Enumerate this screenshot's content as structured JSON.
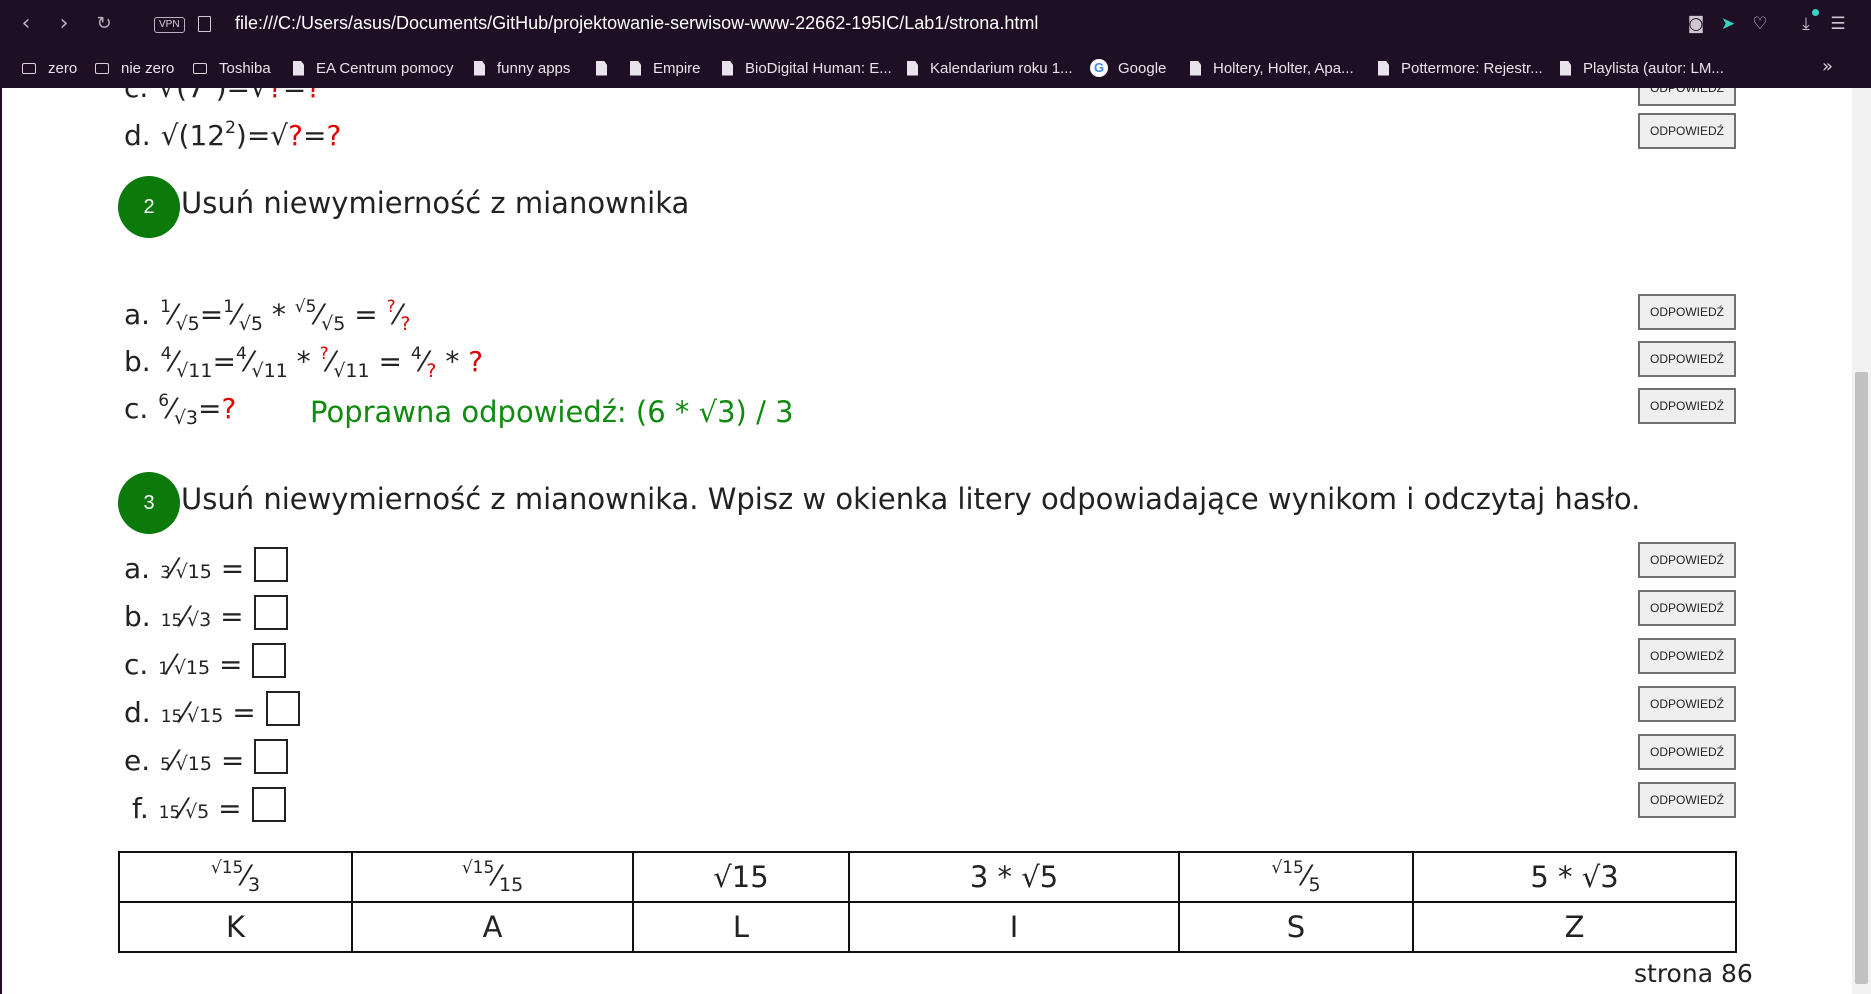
{
  "browser": {
    "vpn_label": "VPN",
    "url": "file:///C:/Users/asus/Documents/GitHub/projektowanie-serwisow-www-22662-195IC/Lab1/strona.html",
    "bookmarks": [
      {
        "label": "zero",
        "icon": "folder-icon"
      },
      {
        "label": "nie zero",
        "icon": "folder-icon"
      },
      {
        "label": "Toshiba",
        "icon": "folder-icon"
      },
      {
        "label": "EA Centrum pomocy",
        "icon": "page-icon"
      },
      {
        "label": "funny apps",
        "icon": "page-icon"
      },
      {
        "label": "",
        "icon": "page-icon"
      },
      {
        "label": "Empire",
        "icon": "page-icon"
      },
      {
        "label": "BioDigital Human: E...",
        "icon": "page-icon"
      },
      {
        "label": "Kalendarium roku 1...",
        "icon": "page-icon"
      },
      {
        "label": "Google",
        "icon": "google-icon"
      },
      {
        "label": "Holtery, Holter, Apa...",
        "icon": "page-icon"
      },
      {
        "label": "Pottermore: Rejestr...",
        "icon": "page-icon"
      },
      {
        "label": "Playlista (autor: LM...",
        "icon": "page-icon"
      }
    ],
    "more": "»"
  },
  "answer_label": "ODPOWIEDŹ",
  "section1": {
    "c_label": "c.",
    "d_label": "d.",
    "d_base": "12",
    "d_exp": "2"
  },
  "section2": {
    "number": "2",
    "heading": "Usuń niewymierność z mianownika",
    "items": [
      {
        "label": "a."
      },
      {
        "label": "b."
      },
      {
        "label": "c."
      }
    ],
    "correct": "Poprawna odpowiedź: (6 * √3) / 3"
  },
  "section3": {
    "number": "3",
    "heading": "Usuń niewymierność z mianownika. Wpisz w okienka litery odpowiadające wynikom i odczytaj hasło.",
    "items": [
      {
        "label": "a.",
        "num": "3",
        "den": "√15"
      },
      {
        "label": "b.",
        "num": "15",
        "den": "√3"
      },
      {
        "label": "c.",
        "num": "1",
        "den": "√15"
      },
      {
        "label": "d.",
        "num": "15",
        "den": "√15"
      },
      {
        "label": "e.",
        "num": "5",
        "den": "√15"
      },
      {
        "label": "f.",
        "num": "15",
        "den": "√5"
      }
    ]
  },
  "table": {
    "values": [
      "√15/3",
      "√15/15",
      "√15",
      "3 * √5",
      "√15/5",
      "5 * √3"
    ],
    "letters": [
      "K",
      "A",
      "L",
      "I",
      "S",
      "Z"
    ]
  },
  "page_number": "strona 86"
}
